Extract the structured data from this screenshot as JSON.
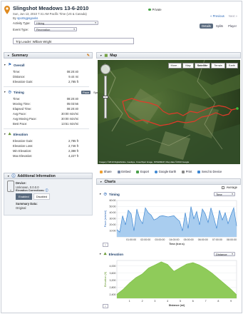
{
  "header": {
    "title": "Slingshot Meadows 13-6-2010",
    "date_line": "Sun, Jun 13, 2010 7:41 AM Pacific Time (US & Canada)",
    "by_prefix": "By",
    "author": "sportsgpsgeeks",
    "activity_type_label": "Activity Type:",
    "activity_type_value": "Hiking",
    "event_type_label": "Event Type:",
    "event_type_value": "Recreation",
    "notes": "Trip Leader: William Wright",
    "privacy": "Private",
    "prev_link": "« Previous",
    "next_link": "Next »",
    "view_tabs": [
      "Details",
      "Splits",
      "Player"
    ]
  },
  "summary": {
    "title": "Summary",
    "overall": {
      "title": "Overall",
      "rows": [
        {
          "label": "Time:",
          "value": "08:20:40"
        },
        {
          "label": "Distance:",
          "value": "9.44 mi"
        },
        {
          "label": "Elevation Gain:",
          "value": "2,785 ft"
        }
      ]
    },
    "timing": {
      "title": "Timing",
      "toggle": [
        "Pace",
        "Speed"
      ],
      "rows": [
        {
          "label": "Time:",
          "value": "08:20:40"
        },
        {
          "label": "Moving Time:",
          "value": "05:03:56"
        },
        {
          "label": "Elapsed Time:",
          "value": "08:20:40"
        },
        {
          "label": "Avg Pace:",
          "value": "30:00 min/mi"
        },
        {
          "label": "Avg Moving Pace:",
          "value": "30:00 min/mi"
        },
        {
          "label": "Best Pace:",
          "value": "13:51 min/mi"
        }
      ]
    },
    "elevation": {
      "title": "Elevation",
      "rows": [
        {
          "label": "Elevation Gain:",
          "value": "2,785 ft"
        },
        {
          "label": "Elevation Loss:",
          "value": "2,746 ft"
        },
        {
          "label": "Min Elevation:",
          "value": "2,388 ft"
        },
        {
          "label": "Max Elevation:",
          "value": "4,227 ft"
        }
      ]
    }
  },
  "additional": {
    "title": "Additional Information",
    "device_label": "Device:",
    "device_value": "Unknown, 0.0.0.0",
    "elev_corr_label": "Elevation Corrections:",
    "elev_corr_buttons": [
      "Enabled",
      "Disabled"
    ],
    "summary_data_label": "Summary Data:",
    "summary_data_value": "Original"
  },
  "map": {
    "title": "Map",
    "buttons": [
      "More...",
      "Map",
      "Satellite",
      "Terrain",
      "Earth"
    ],
    "credit": "Imagery ©2010 DigitalGlobe, GeoEye, Cnes/Spot Image, INTERMAP, Map data ©2010 Google"
  },
  "actions": [
    "Share",
    "Embed",
    "Export",
    "Google Earth",
    "Print",
    "Send to Device"
  ],
  "charts": {
    "title": "Charts",
    "average_label": "Average",
    "timing": {
      "title": "Timing",
      "selector": "Time"
    },
    "elevation": {
      "title": "Elevation",
      "selector": "Distance"
    }
  },
  "chart_data": [
    {
      "type": "area",
      "title": "",
      "xlabel": "Time (h:m:s)",
      "ylabel": "Pace (min/mi)",
      "x": [
        "01:00:00",
        "02:00:00",
        "03:00:00",
        "04:00:00",
        "05:00:00",
        "06:00:00",
        "07:00:00",
        "08:00:00"
      ],
      "yticks": [
        "10:00",
        "20:00",
        "30:00",
        "40:00",
        "50:00",
        "60:00"
      ],
      "ylim_minutes": [
        0,
        60
      ],
      "series": [
        {
          "values": [
            12,
            8,
            35,
            20,
            44,
            38,
            10,
            46,
            30,
            22,
            48,
            40,
            36,
            28,
            30,
            34,
            35,
            34,
            33,
            34,
            35,
            30,
            26,
            10,
            40,
            14,
            50,
            30,
            42,
            20,
            46,
            38,
            24,
            48,
            32,
            14,
            44,
            28,
            40,
            22,
            36,
            48,
            18
          ]
        }
      ],
      "color": "#3d86d1"
    },
    {
      "type": "area",
      "title": "",
      "xlabel": "Distance (mi)",
      "ylabel": "Elevation (ft)",
      "x": [
        0,
        0.5,
        1,
        1.5,
        2,
        2.5,
        3,
        3.5,
        4,
        4.5,
        5,
        5.5,
        6,
        6.5,
        7,
        7.5,
        8,
        8.5,
        9,
        9.44
      ],
      "xticks": [
        1,
        2,
        3,
        4,
        5,
        6,
        7,
        8,
        9
      ],
      "yticks": [
        "2,400",
        "2,800",
        "3,200",
        "3,600",
        "4,000"
      ],
      "ylim": [
        2200,
        4300
      ],
      "series": [
        {
          "values": [
            2420,
            2700,
            3050,
            3350,
            3550,
            3880,
            4050,
            4227,
            4080,
            3700,
            3900,
            4100,
            4180,
            4050,
            3850,
            3600,
            3300,
            3000,
            2700,
            2400
          ]
        }
      ],
      "color": "#7fbf48"
    }
  ]
}
